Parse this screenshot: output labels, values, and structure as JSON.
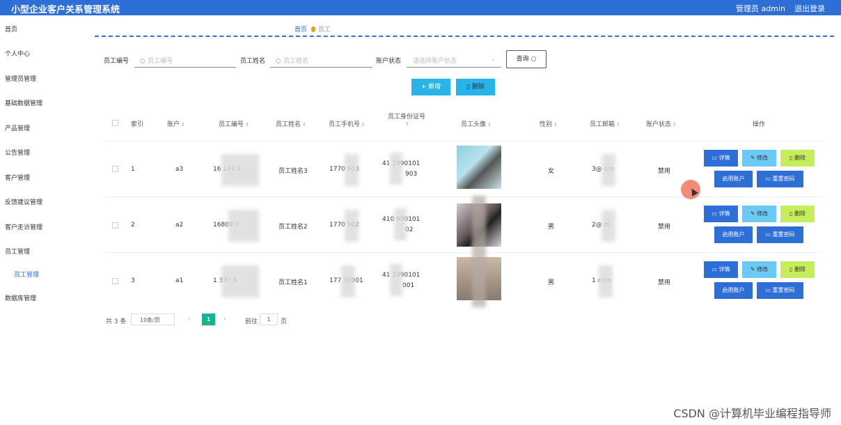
{
  "header": {
    "title": "小型企业客户关系管理系统",
    "user": "管理员 admin",
    "logout": "退出登录"
  },
  "sidebar": [
    "首页",
    "个人中心",
    "管理员管理",
    "基础数据管理",
    "产品管理",
    "公告管理",
    "客户管理",
    "反馈建议管理",
    "客户走访管理",
    "员工管理",
    "员工管理",
    "数据库管理"
  ],
  "breadcrumb": {
    "home": "首页",
    "current": "员工"
  },
  "filters": {
    "no_label": "员工编号",
    "no_placeholder": "员工编号",
    "name_label": "员工姓名",
    "name_placeholder": "员工姓名",
    "status_label": "账户状态",
    "status_placeholder": "请选择账户状态",
    "query": "查询"
  },
  "actions": {
    "add": "+ 新增",
    "delete": "删除"
  },
  "table": {
    "headers": [
      "索引",
      "账户",
      "员工编号",
      "员工姓名",
      "员工手机号",
      "员工身份证号",
      "员工头像",
      "性别",
      "员工邮箱",
      "账户状态",
      "操作"
    ],
    "rows": [
      {
        "index": "1",
        "account": "a3",
        "no": "16     171     3",
        "name": "员工姓名3",
        "phone": "1770      903",
        "idcard1": "41      1990101",
        "idcard2": "903",
        "gender": "女",
        "email": "3@       om",
        "status": "禁用"
      },
      {
        "index": "2",
        "account": "a2",
        "no": "16809          0",
        "name": "员工姓名2",
        "phone": "1770      902",
        "idcard1": "410      990101",
        "idcard2": "02",
        "gender": "男",
        "email": "2@       m",
        "status": "禁用"
      },
      {
        "index": "3",
        "account": "a1",
        "no": "1      337      6",
        "name": "员工姓名1",
        "phone": "177      36901",
        "idcard1": "41       1990101",
        "idcard2": "001",
        "gender": "男",
        "email": "1        com",
        "status": "禁用"
      }
    ],
    "ops": {
      "detail": "详情",
      "edit": "修改",
      "delete": "删除",
      "enable": "启用账户",
      "reset": "重置密码"
    }
  },
  "pager": {
    "total": "共 3 条",
    "size": "10条/页",
    "current": "1",
    "goto": "前往",
    "goto_value": "1",
    "page": "页"
  },
  "watermark": "CSDN @计算机毕业编程指导师"
}
